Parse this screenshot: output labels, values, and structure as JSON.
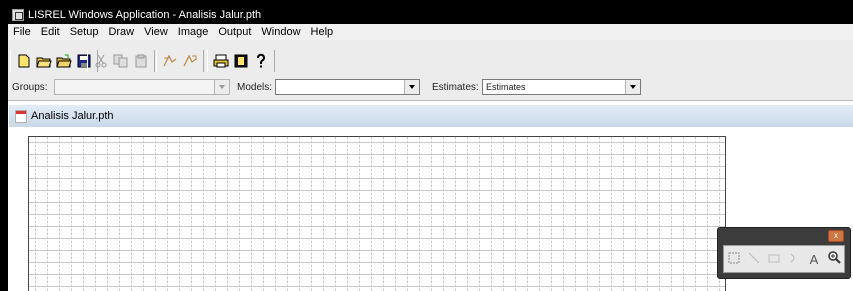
{
  "window": {
    "title": "LISREL Windows Application - Analisis Jalur.pth"
  },
  "menu": [
    "File",
    "Edit",
    "Setup",
    "Draw",
    "View",
    "Image",
    "Output",
    "Window",
    "Help"
  ],
  "toolbar": {
    "icons": [
      "new-icon",
      "open-icon",
      "open-folder-icon",
      "save-icon",
      "cut-icon",
      "copy-icon",
      "paste-icon",
      "path-icon",
      "path-alt-icon",
      "print-icon",
      "info-icon",
      "help-icon"
    ]
  },
  "selectors": {
    "groups_label": "Groups:",
    "groups_value": "",
    "models_label": "Models:",
    "models_value": "",
    "estimates_label": "Estimates:",
    "estimates_value": "Estimates"
  },
  "document": {
    "title": "Analisis Jalur.pth"
  },
  "draw_tools": {
    "close_glyph": "x",
    "tools": [
      "select-icon",
      "line-icon",
      "rectangle-icon",
      "curve-icon",
      "text-icon",
      "zoom-icon"
    ],
    "text_tool_glyph": "A"
  },
  "colors": {
    "title_bar": "#000000",
    "doc_title_bar": "#cad8e8",
    "grid": "#c9c9c9"
  }
}
